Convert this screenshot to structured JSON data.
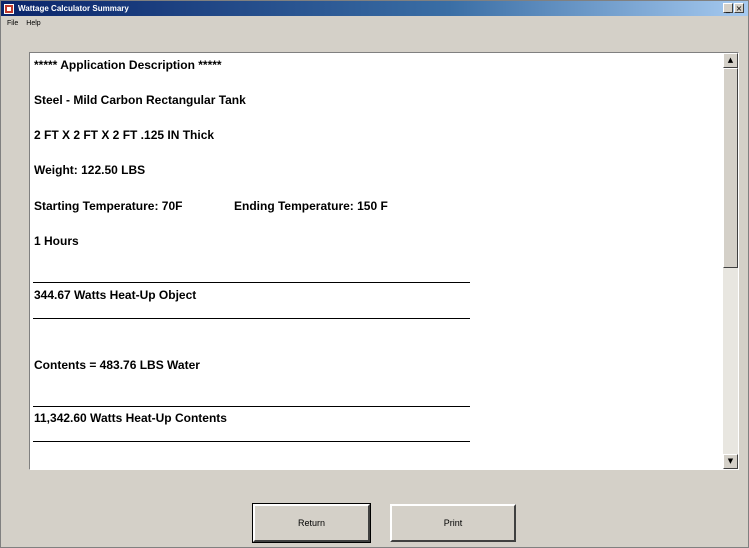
{
  "window": {
    "title": "Wattage Calculator Summary",
    "controls": {
      "minimize": "_",
      "close": "×"
    }
  },
  "menu": {
    "items": [
      "File",
      "Help"
    ]
  },
  "report": {
    "heading": "***** Application Description *****",
    "material": "Steel - Mild Carbon Rectangular Tank",
    "dimensions": "2 FT X 2 FT X 2 FT .125 IN Thick",
    "weight": "Weight: 122.50 LBS",
    "start_temp": "Starting Temperature: 70F",
    "end_temp": "Ending Temperature: 150 F",
    "duration": "1 Hours",
    "object_watts": "344.67 Watts Heat-Up Object",
    "contents": "Contents = 483.76 LBS Water",
    "contents_watts": "11,342.60 Watts Heat-Up Contents"
  },
  "scrollbar": {
    "up": "▲",
    "down": "▼"
  },
  "buttons": {
    "return_label": "Return",
    "print_label": "Print"
  }
}
